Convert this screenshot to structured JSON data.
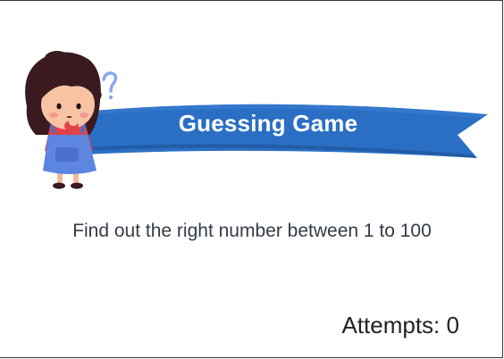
{
  "game": {
    "title": "Guessing Game",
    "instruction": "Find out the right number between 1 to 100",
    "attempts_label": "Attempts:",
    "attempts_count": "0"
  },
  "colors": {
    "banner_blue": "#2a6fc4",
    "banner_dark": "#1f4f93",
    "question_mark": "#8aa8f0"
  },
  "icons": {
    "mascot": "thinking-girl-icon",
    "question": "question-mark-icon"
  }
}
